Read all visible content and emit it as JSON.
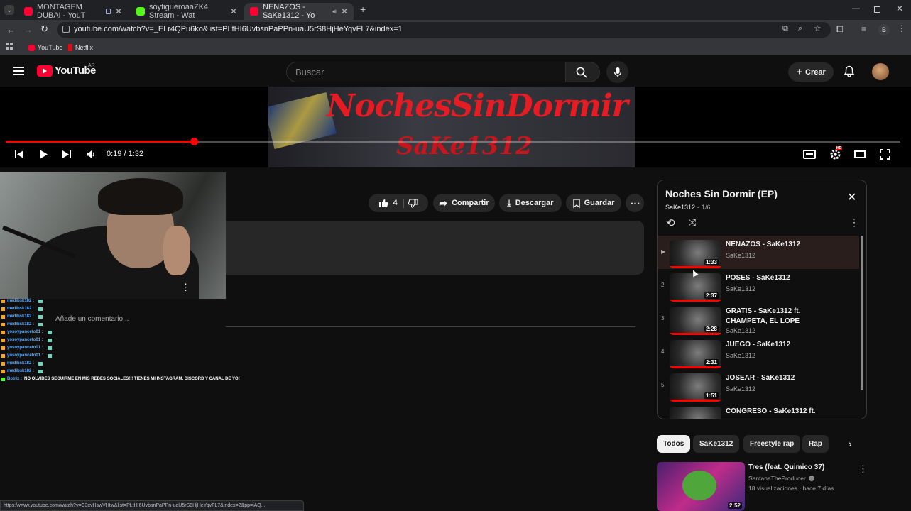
{
  "browser": {
    "tabs": [
      {
        "title": "MONTAGEM DUBAI - YouT",
        "favicon_color": "#ff0033"
      },
      {
        "title": "soyfigueroaaZK4 Stream - Wat",
        "favicon_color": "#53fc18"
      },
      {
        "title": "NENAZOS - SaKe1312 - Yo",
        "favicon_color": "#ff0033"
      }
    ],
    "url": "youtube.com/watch?v=_ELr4QPu6ko&list=PLtHI6UvbsnPaPPn-uaU5rS8HjHeYqvFL7&index=1",
    "profile_initial": "B",
    "bookmarks": [
      "YouTube",
      "Netflix"
    ],
    "status_url": "https://www.youtube.com/watch?v=C3xvHswVHtw&list=PLtHI6UvbsnPaPPn-uaU5rS8HjHeYqvFL7&index=2&pp=iAQ..."
  },
  "youtube": {
    "logo": "YouTube",
    "region": "AR",
    "search_placeholder": "Buscar",
    "create_label": "Crear",
    "settings_badge": "HD"
  },
  "video": {
    "art_title": "NochesSinDormir",
    "art_subtitle": "SaKe1312",
    "time": "0:19 / 1:32",
    "progress_fraction": 0.21
  },
  "actions": {
    "likes": "4",
    "share": "Compartir",
    "download": "Descargar",
    "save": "Guardar"
  },
  "comments": {
    "placeholder": "Añade un comentario..."
  },
  "chat": [
    {
      "user": "medibsk182 :",
      "msg": ""
    },
    {
      "user": "medibsk182 :",
      "msg": ""
    },
    {
      "user": "medibsk182 :",
      "msg": ""
    },
    {
      "user": "medibsk182 :",
      "msg": ""
    },
    {
      "user": "yosoypanceto01 :",
      "msg": ""
    },
    {
      "user": "yosoypanceto01 :",
      "msg": ""
    },
    {
      "user": "yosoypanceto01 :",
      "msg": ""
    },
    {
      "user": "yosoypanceto01 :",
      "msg": ""
    },
    {
      "user": "medibsk182 :",
      "msg": ""
    },
    {
      "user": "medibsk182 :",
      "msg": ""
    },
    {
      "user": "Botrix :",
      "msg": "NO OLVIDES SEGUIRME EN MIS REDES SOCIALES!!! TIENES MI INSTAGRAM, DISCORD Y CANAL DE YO!"
    }
  ],
  "playlist": {
    "title": "Noches Sin Dormir (EP)",
    "owner": "SaKe1312",
    "position": "1/6",
    "items": [
      {
        "index": "▶",
        "title": "NENAZOS - SaKe1312",
        "channel": "SaKe1312",
        "duration": "1:33",
        "current": true
      },
      {
        "index": "2",
        "title": "POSES - SaKe1312",
        "channel": "SaKe1312",
        "duration": "2:37",
        "current": false
      },
      {
        "index": "3",
        "title": "GRATIS - SaKe1312 ft. CHAMPETA, EL LOPE",
        "channel": "SaKe1312",
        "duration": "2:28",
        "current": false
      },
      {
        "index": "4",
        "title": "JUEGO - SaKe1312",
        "channel": "SaKe1312",
        "duration": "2:31",
        "current": false
      },
      {
        "index": "5",
        "title": "JOSEAR - SaKe1312",
        "channel": "SaKe1312",
        "duration": "1:51",
        "current": false
      },
      {
        "index": "",
        "title": "CONGRESO - SaKe1312 ft.",
        "channel": "",
        "duration": "",
        "current": false
      }
    ]
  },
  "chips": [
    "Todos",
    "SaKe1312",
    "Freestyle rap",
    "Rap"
  ],
  "recommendation": {
    "title": "Tres (feat. Quimico 37)",
    "channel": "SantanaTheProducer",
    "meta": "18 visualizaciones · hace 7 días",
    "duration": "2:52"
  }
}
